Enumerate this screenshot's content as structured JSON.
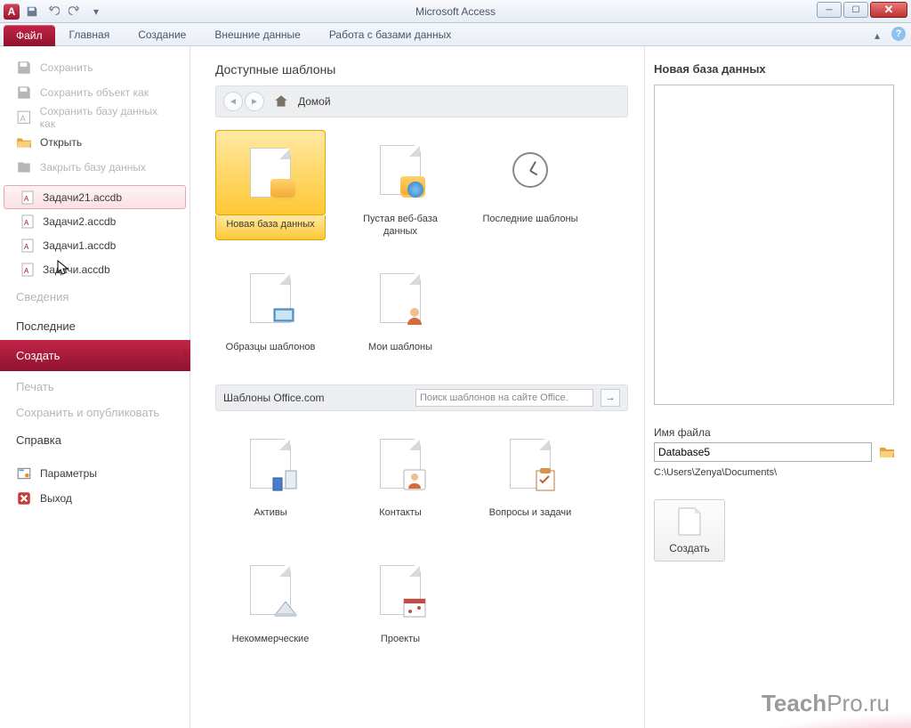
{
  "window": {
    "title": "Microsoft Access",
    "app_letter": "A"
  },
  "ribbon": {
    "file": "Файл",
    "tabs": [
      "Главная",
      "Создание",
      "Внешние данные",
      "Работа с базами данных"
    ]
  },
  "left_menu": {
    "save": "Сохранить",
    "save_object_as": "Сохранить объект как",
    "save_db_as": "Сохранить базу данных как",
    "open": "Открыть",
    "close_db": "Закрыть базу данных",
    "recent_files": [
      "Задачи21.accdb",
      "Задачи2.accdb",
      "Задачи1.accdb",
      "Задачи.accdb"
    ],
    "info": "Сведения",
    "recent": "Последние",
    "create": "Создать",
    "print": "Печать",
    "save_publish": "Сохранить и опубликовать",
    "help": "Справка",
    "options": "Параметры",
    "exit": "Выход"
  },
  "center": {
    "title": "Доступные шаблоны",
    "home": "Домой",
    "row1": [
      {
        "label": "Новая база данных"
      },
      {
        "label": "Пустая веб-база данных"
      },
      {
        "label": "Последние шаблоны"
      }
    ],
    "row2": [
      {
        "label": "Образцы шаблонов"
      },
      {
        "label": "Мои шаблоны"
      }
    ],
    "office_label": "Шаблоны Office.com",
    "search_placeholder": "Поиск шаблонов на сайте Office.",
    "row3": [
      {
        "label": "Активы"
      },
      {
        "label": "Контакты"
      },
      {
        "label": "Вопросы и задачи"
      }
    ],
    "row4": [
      {
        "label": "Некоммерческие"
      },
      {
        "label": "Проекты"
      }
    ]
  },
  "right": {
    "title": "Новая база данных",
    "filename_label": "Имя файла",
    "filename_value": "Database5",
    "path": "C:\\Users\\Zenya\\Documents\\",
    "create_btn": "Создать"
  },
  "brand": "TeachPro.ru"
}
